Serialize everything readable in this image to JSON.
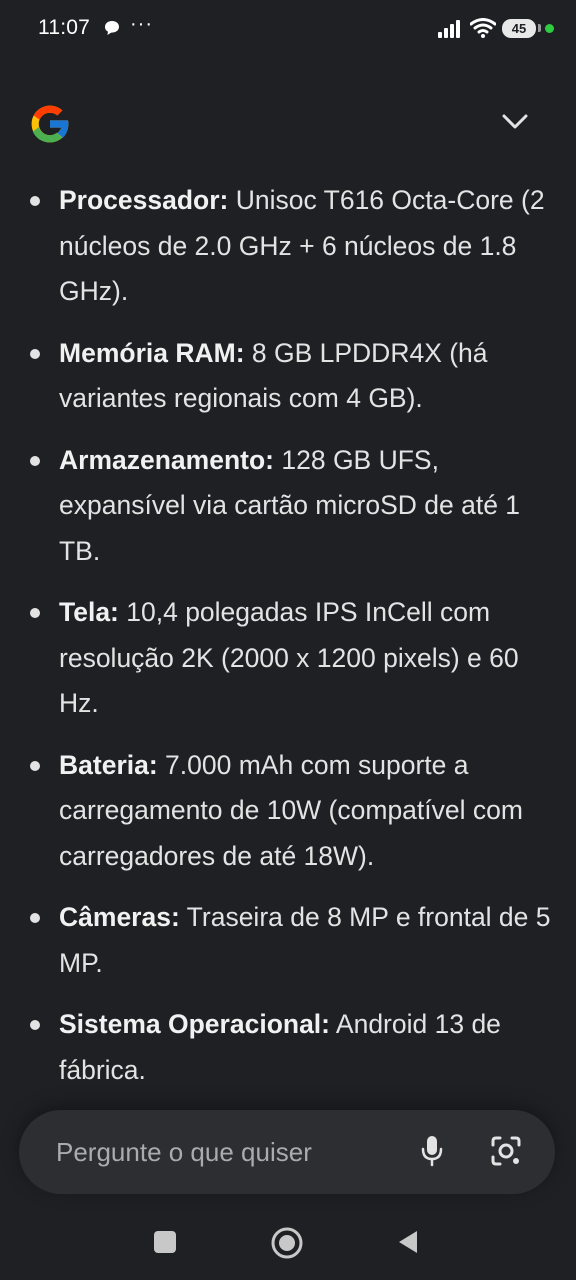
{
  "status_bar": {
    "time": "11:07",
    "more_indicator": "···",
    "battery_level": "45",
    "icons": [
      "message-icon",
      "signal-icon",
      "wifi-icon",
      "battery-icon"
    ]
  },
  "header": {
    "logo": "google-logo",
    "collapse_icon": "chevron-down-icon"
  },
  "specs": [
    {
      "label": "Processador:",
      "text": " Unisoc T616 Octa-Core (2 núcleos de 2.0 GHz + 6 núcleos de 1.8 GHz)."
    },
    {
      "label": "Memória RAM:",
      "text": " 8 GB LPDDR4X (há variantes regionais com 4 GB)."
    },
    {
      "label": "Armazenamento:",
      "text": " 128 GB UFS, expansível via cartão microSD de até 1 TB."
    },
    {
      "label": "Tela:",
      "text": " 10,4 polegadas IPS InCell com resolução 2K (2000 x 1200 pixels) e 60 Hz."
    },
    {
      "label": "Bateria:",
      "text": " 7.000 mAh com suporte a carregamento de 10W (compatível com carregadores de até 18W)."
    },
    {
      "label": "Câmeras:",
      "text": " Traseira de 8 MP e frontal de 5 MP."
    },
    {
      "label": "Sistema Operacional:",
      "text": " Android 13 de fábrica."
    }
  ],
  "prompt": {
    "placeholder": "Pergunte o que quiser",
    "mic_icon": "microphone-icon",
    "lens_icon": "camera-search-icon"
  },
  "nav_bar": {
    "icons": [
      "recents-icon",
      "home-icon",
      "back-icon"
    ]
  },
  "colors": {
    "background": "#1f2023",
    "text": "#e3e3e3",
    "prompt_bg": "#2d2e31",
    "status_dot": "#2ecc40"
  }
}
